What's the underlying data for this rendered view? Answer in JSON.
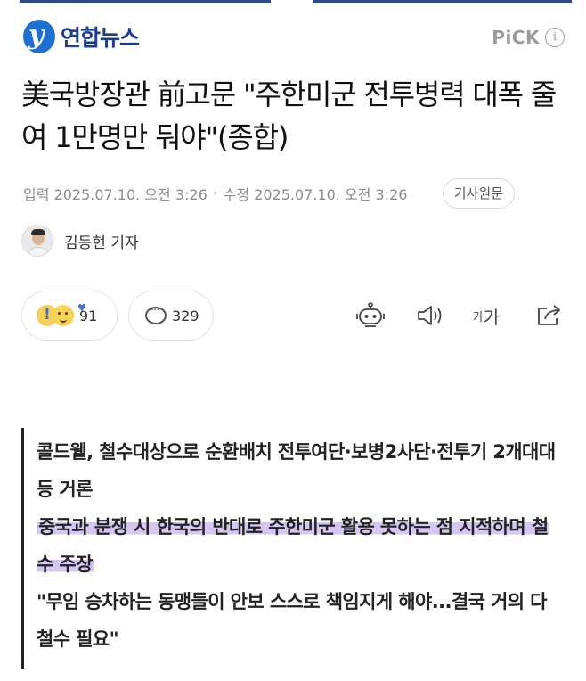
{
  "header": {
    "logo_text": "연합뉴스",
    "logo_mark": "y",
    "pick_label": "PiCK",
    "info_icon": "i"
  },
  "headline": "美국방장관 前고문 \"주한미군 전투병력 대폭 줄여 1만명만 둬야\"(종합)",
  "meta": {
    "published": "입력 2025.07.10. 오전 3:26",
    "separator": "•",
    "updated": "수정 2025.07.10. 오전 3:26",
    "source_button": "기사원문"
  },
  "author": {
    "name": "김동현 기자"
  },
  "actions": {
    "reaction_count": "91",
    "comment_count": "329",
    "font_small": "가",
    "font_big": "가"
  },
  "summary": {
    "line1": "콜드웰, 철수대상으로 순환배치 전투여단·보병2사단·전투기 2개대대 등 거론",
    "line2": "중국과 분쟁 시 한국의 반대로 주한미군 활용 못하는 점 지적하며 철수 주장",
    "line3": "\"무임 승차하는 동맹들이 안보 스스로 책임지게 해야...결국 거의 다 철수 필요\""
  },
  "colors": {
    "brand_blue": "#1a3d8f",
    "logo_blue": "#1f6fd1",
    "highlight": "#d4c7f2",
    "meta_gray": "#8c8c8c"
  }
}
